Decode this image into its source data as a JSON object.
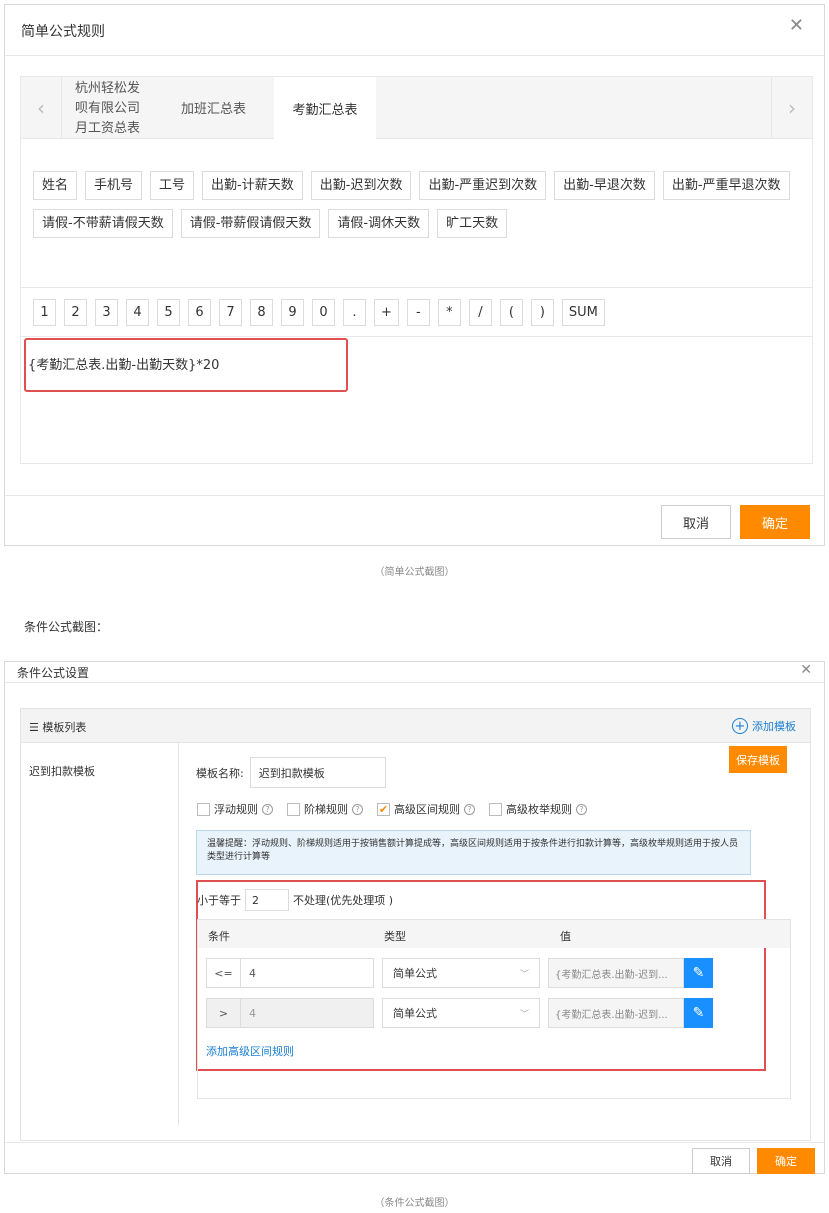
{
  "dialog1": {
    "title": "简单公式规则",
    "close": "✕",
    "tabs": [
      "杭州轻松发\n呗有限公司\n月工资总表",
      "加班汇总表",
      "考勤汇总表"
    ],
    "fields": [
      "姓名",
      "手机号",
      "工号",
      "出勤-计薪天数",
      "出勤-迟到次数",
      "出勤-严重迟到次数",
      "出勤-早退次数",
      "出勤-严重早退次数",
      "请假-不带薪请假天数",
      "请假-带薪假请假天数",
      "请假-调休天数",
      "旷工天数"
    ],
    "keys": [
      "1",
      "2",
      "3",
      "4",
      "5",
      "6",
      "7",
      "8",
      "9",
      "0",
      ".",
      "+",
      "-",
      "*",
      "/",
      "(",
      ")",
      "SUM"
    ],
    "formula": "{考勤汇总表.出勤-出勤天数}*20",
    "cancel": "取消",
    "ok": "确定"
  },
  "caption1": "（简单公式截图）",
  "section_label": "条件公式截图：",
  "dialog2": {
    "title": "条件公式设置",
    "close": "✕",
    "template_list_label": "☰ 模板列表",
    "add_template": "添加模板",
    "template_item": "迟到扣款模板",
    "name_label": "模板名称:",
    "name_value": "迟到扣款模板",
    "checks": [
      {
        "label": "浮动规则",
        "checked": ""
      },
      {
        "label": "阶梯规则",
        "checked": ""
      },
      {
        "label": "高级区间规则",
        "checked": "✔"
      },
      {
        "label": "高级枚举规则",
        "checked": ""
      }
    ],
    "tip": "温馨提醒：浮动规则、阶梯规则适用于按销售额计算提成等，高级区间规则适用于按条件进行扣款计算等，高级枚举规则适用于按人员类型进行计算等",
    "range_prefix": "小于等于",
    "range_value": "2",
    "range_suffix": "不处理(优先处理项 )",
    "grid_headers": [
      "条件",
      "类型",
      "值"
    ],
    "rows": [
      {
        "op": "<=",
        "value": "4",
        "type": "简单公式",
        "formula": "{考勤汇总表.出勤-迟到..."
      },
      {
        "op": ">",
        "value": "4",
        "type": "简单公式",
        "formula": "{考勤汇总表.出勤-迟到..."
      }
    ],
    "add_rule": "添加高级区间规则",
    "save_template": "保存模板",
    "cancel": "取消",
    "ok": "确定"
  },
  "caption2": "（条件公式截图）"
}
